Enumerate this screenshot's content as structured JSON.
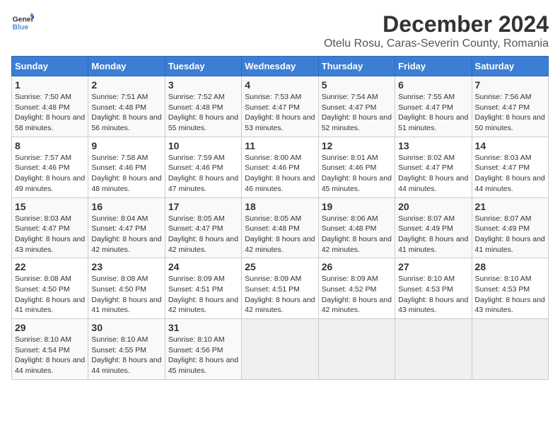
{
  "header": {
    "logo_line1": "General",
    "logo_line2": "Blue",
    "title": "December 2024",
    "subtitle": "Otelu Rosu, Caras-Severin County, Romania"
  },
  "weekdays": [
    "Sunday",
    "Monday",
    "Tuesday",
    "Wednesday",
    "Thursday",
    "Friday",
    "Saturday"
  ],
  "weeks": [
    [
      {
        "day": "1",
        "sunrise": "7:50 AM",
        "sunset": "4:48 PM",
        "daylight": "8 hours and 58 minutes."
      },
      {
        "day": "2",
        "sunrise": "7:51 AM",
        "sunset": "4:48 PM",
        "daylight": "8 hours and 56 minutes."
      },
      {
        "day": "3",
        "sunrise": "7:52 AM",
        "sunset": "4:48 PM",
        "daylight": "8 hours and 55 minutes."
      },
      {
        "day": "4",
        "sunrise": "7:53 AM",
        "sunset": "4:47 PM",
        "daylight": "8 hours and 53 minutes."
      },
      {
        "day": "5",
        "sunrise": "7:54 AM",
        "sunset": "4:47 PM",
        "daylight": "8 hours and 52 minutes."
      },
      {
        "day": "6",
        "sunrise": "7:55 AM",
        "sunset": "4:47 PM",
        "daylight": "8 hours and 51 minutes."
      },
      {
        "day": "7",
        "sunrise": "7:56 AM",
        "sunset": "4:47 PM",
        "daylight": "8 hours and 50 minutes."
      }
    ],
    [
      {
        "day": "8",
        "sunrise": "7:57 AM",
        "sunset": "4:46 PM",
        "daylight": "8 hours and 49 minutes."
      },
      {
        "day": "9",
        "sunrise": "7:58 AM",
        "sunset": "4:46 PM",
        "daylight": "8 hours and 48 minutes."
      },
      {
        "day": "10",
        "sunrise": "7:59 AM",
        "sunset": "4:46 PM",
        "daylight": "8 hours and 47 minutes."
      },
      {
        "day": "11",
        "sunrise": "8:00 AM",
        "sunset": "4:46 PM",
        "daylight": "8 hours and 46 minutes."
      },
      {
        "day": "12",
        "sunrise": "8:01 AM",
        "sunset": "4:46 PM",
        "daylight": "8 hours and 45 minutes."
      },
      {
        "day": "13",
        "sunrise": "8:02 AM",
        "sunset": "4:47 PM",
        "daylight": "8 hours and 44 minutes."
      },
      {
        "day": "14",
        "sunrise": "8:03 AM",
        "sunset": "4:47 PM",
        "daylight": "8 hours and 44 minutes."
      }
    ],
    [
      {
        "day": "15",
        "sunrise": "8:03 AM",
        "sunset": "4:47 PM",
        "daylight": "8 hours and 43 minutes."
      },
      {
        "day": "16",
        "sunrise": "8:04 AM",
        "sunset": "4:47 PM",
        "daylight": "8 hours and 42 minutes."
      },
      {
        "day": "17",
        "sunrise": "8:05 AM",
        "sunset": "4:47 PM",
        "daylight": "8 hours and 42 minutes."
      },
      {
        "day": "18",
        "sunrise": "8:05 AM",
        "sunset": "4:48 PM",
        "daylight": "8 hours and 42 minutes."
      },
      {
        "day": "19",
        "sunrise": "8:06 AM",
        "sunset": "4:48 PM",
        "daylight": "8 hours and 42 minutes."
      },
      {
        "day": "20",
        "sunrise": "8:07 AM",
        "sunset": "4:49 PM",
        "daylight": "8 hours and 41 minutes."
      },
      {
        "day": "21",
        "sunrise": "8:07 AM",
        "sunset": "4:49 PM",
        "daylight": "8 hours and 41 minutes."
      }
    ],
    [
      {
        "day": "22",
        "sunrise": "8:08 AM",
        "sunset": "4:50 PM",
        "daylight": "8 hours and 41 minutes."
      },
      {
        "day": "23",
        "sunrise": "8:08 AM",
        "sunset": "4:50 PM",
        "daylight": "8 hours and 41 minutes."
      },
      {
        "day": "24",
        "sunrise": "8:09 AM",
        "sunset": "4:51 PM",
        "daylight": "8 hours and 42 minutes."
      },
      {
        "day": "25",
        "sunrise": "8:09 AM",
        "sunset": "4:51 PM",
        "daylight": "8 hours and 42 minutes."
      },
      {
        "day": "26",
        "sunrise": "8:09 AM",
        "sunset": "4:52 PM",
        "daylight": "8 hours and 42 minutes."
      },
      {
        "day": "27",
        "sunrise": "8:10 AM",
        "sunset": "4:53 PM",
        "daylight": "8 hours and 43 minutes."
      },
      {
        "day": "28",
        "sunrise": "8:10 AM",
        "sunset": "4:53 PM",
        "daylight": "8 hours and 43 minutes."
      }
    ],
    [
      {
        "day": "29",
        "sunrise": "8:10 AM",
        "sunset": "4:54 PM",
        "daylight": "8 hours and 44 minutes."
      },
      {
        "day": "30",
        "sunrise": "8:10 AM",
        "sunset": "4:55 PM",
        "daylight": "8 hours and 44 minutes."
      },
      {
        "day": "31",
        "sunrise": "8:10 AM",
        "sunset": "4:56 PM",
        "daylight": "8 hours and 45 minutes."
      },
      null,
      null,
      null,
      null
    ]
  ]
}
